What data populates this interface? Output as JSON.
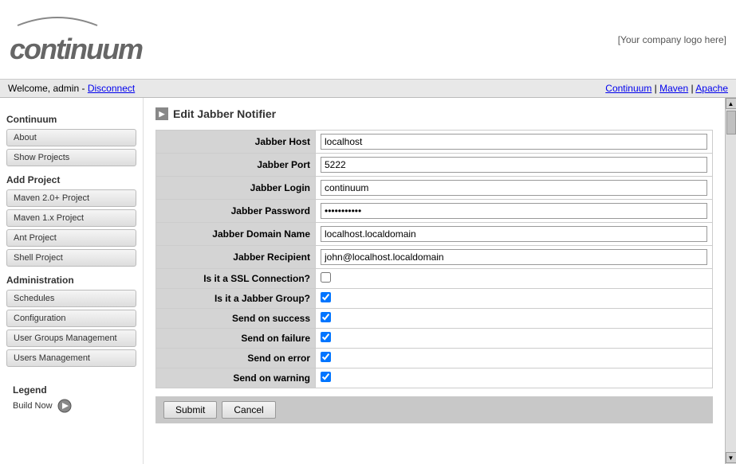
{
  "header": {
    "company_logo": "[Your company logo here]",
    "logo_main": "continuum"
  },
  "navbar": {
    "welcome": "Welcome, admin",
    "disconnect": "Disconnect",
    "nav_links": [
      "Continuum",
      "Maven",
      "Apache"
    ]
  },
  "sidebar": {
    "sections": [
      {
        "title": "Continuum",
        "items": [
          "About",
          "Show Projects"
        ]
      },
      {
        "title": "Add Project",
        "items": [
          "Maven 2.0+ Project",
          "Maven 1.x Project",
          "Ant Project",
          "Shell Project"
        ]
      },
      {
        "title": "Administration",
        "items": [
          "Schedules",
          "Configuration",
          "User Groups Management",
          "Users Management"
        ]
      }
    ]
  },
  "legend": {
    "title": "Legend",
    "items": [
      "Build Now"
    ]
  },
  "page_title": "Edit Jabber Notifier",
  "form": {
    "fields": [
      {
        "label": "Jabber Host",
        "type": "text",
        "value": "localhost"
      },
      {
        "label": "Jabber Port",
        "type": "text",
        "value": "5222"
      },
      {
        "label": "Jabber Login",
        "type": "text",
        "value": "continuum"
      },
      {
        "label": "Jabber Password",
        "type": "password",
        "value": "·········"
      },
      {
        "label": "Jabber Domain Name",
        "type": "text",
        "value": "localhost.localdomain"
      },
      {
        "label": "Jabber Recipient",
        "type": "text",
        "value": "john@localhost.localdomain"
      }
    ],
    "checkboxes": [
      {
        "label": "Is it a SSL Connection?",
        "checked": false
      },
      {
        "label": "Is it a Jabber Group?",
        "checked": true
      },
      {
        "label": "Send on success",
        "checked": true
      },
      {
        "label": "Send on failure",
        "checked": true
      },
      {
        "label": "Send on error",
        "checked": true
      },
      {
        "label": "Send on warning",
        "checked": true
      }
    ],
    "buttons": {
      "submit": "Submit",
      "cancel": "Cancel"
    }
  }
}
